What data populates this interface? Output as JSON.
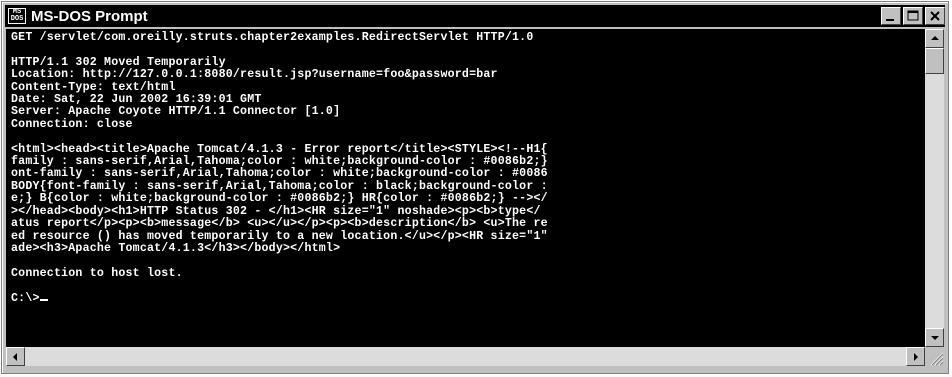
{
  "window": {
    "title": "MS-DOS Prompt",
    "icon_text_top": "MS",
    "icon_text_bottom": "DOS",
    "controls": [
      "minimize-icon",
      "maximize-icon",
      "close-icon"
    ]
  },
  "console": {
    "lines": [
      "GET /servlet/com.oreilly.struts.chapter2examples.RedirectServlet HTTP/1.0",
      "",
      "HTTP/1.1 302 Moved Temporarily",
      "Location: http://127.0.0.1:8080/result.jsp?username=foo&password=bar",
      "Content-Type: text/html",
      "Date: Sat, 22 Jun 2002 16:39:01 GMT",
      "Server: Apache Coyote HTTP/1.1 Connector [1.0]",
      "Connection: close",
      "",
      "<html><head><title>Apache Tomcat/4.1.3 - Error report</title><STYLE><!--H1{",
      "family : sans-serif,Arial,Tahoma;color : white;background-color : #0086b2;}",
      "ont-family : sans-serif,Arial,Tahoma;color : white;background-color : #0086",
      "BODY{font-family : sans-serif,Arial,Tahoma;color : black;background-color :",
      "e;} B{color : white;background-color : #0086b2;} HR{color : #0086b2;} --></",
      "></head><body><h1>HTTP Status 302 - </h1><HR size=\"1\" noshade><p><b>type</",
      "atus report</p><p><b>message</b> <u></u></p><p><b>description</b> <u>The re",
      "ed resource () has moved temporarily to a new location.</u></p><HR size=\"1\"",
      "ade><h3>Apache Tomcat/4.1.3</h3></body></html>",
      "",
      "Connection to host lost.",
      "",
      "C:\\>"
    ]
  },
  "scrollbars": {
    "vertical": {
      "position": 0.0
    },
    "horizontal": {
      "position": 0.0
    }
  },
  "colors": {
    "console_bg": "#000000",
    "console_fg": "#ffffff",
    "titlebar_bg": "#000000",
    "chrome": "#c0c0c0"
  }
}
